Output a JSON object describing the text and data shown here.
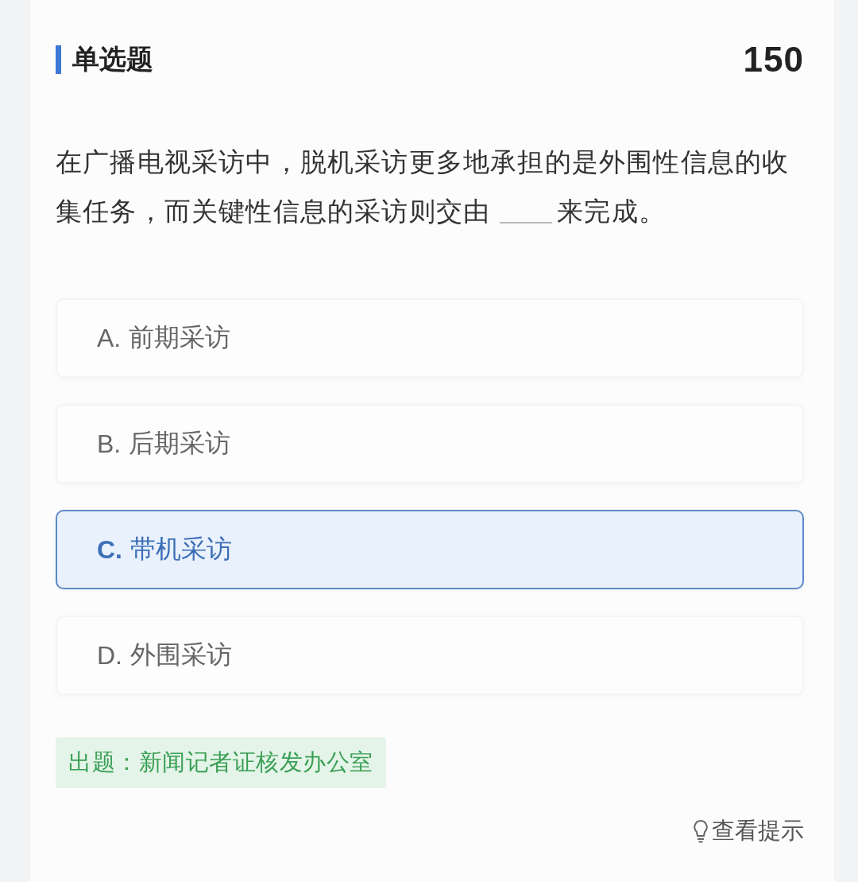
{
  "header": {
    "title": "单选题",
    "number": "150"
  },
  "question": {
    "text_before_blank": "在广播电视采访中，脱机采访更多地承担的是外围性信息的收集任务，而关键性信息的采访则交由",
    "text_after_blank": "来完成。"
  },
  "options": [
    {
      "letter": "A.",
      "text": "前期采访",
      "selected": false
    },
    {
      "letter": "B.",
      "text": "后期采访",
      "selected": false
    },
    {
      "letter": "C.",
      "text": "带机采访",
      "selected": true
    },
    {
      "letter": "D.",
      "text": "外围采访",
      "selected": false
    }
  ],
  "source_tag": "出题：新闻记者证核发办公室",
  "hint_link": "查看提示"
}
